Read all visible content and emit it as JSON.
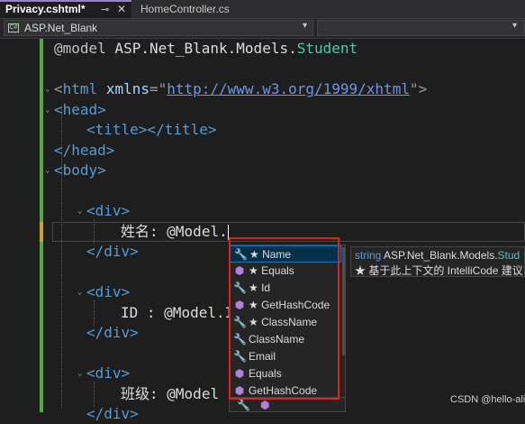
{
  "tabs": [
    {
      "label": "Privacy.cshtml*",
      "pin": "⊸",
      "close": "✕",
      "active": true
    },
    {
      "label": "HomeController.cs",
      "active": false
    }
  ],
  "navbar": {
    "project": "ASP.Net_Blank",
    "chevron": "▾"
  },
  "code": {
    "l1_at": "@model",
    "l1_ns": " ASP.Net_Blank.Models.",
    "l1_type": "Student",
    "l2_open": "<",
    "l2_tag": "html",
    "l2_attr": " xmlns",
    "l2_eq": "=\"",
    "l2_url": "http://www.w3.org/1999/xhtml",
    "l2_close": "\">",
    "l3": "<head>",
    "l4": "<title></title>",
    "l5": "</head>",
    "l6": "<body>",
    "l7": "<div>",
    "l8_text": "姓名: ",
    "l8_model": "@Model.",
    "l9": "</div>",
    "l10": "<div>",
    "l11_text": "ID : ",
    "l11_model": "@Model.I",
    "l12": "</div>",
    "l13": "<div>",
    "l14_text": "班级: ",
    "l14_model": "@Model",
    "l15": "</div>"
  },
  "completion": {
    "items": [
      {
        "icon": "wrench-icon",
        "glyph": "🔧",
        "label": "★ Name",
        "selected": true
      },
      {
        "icon": "method-cube-icon",
        "glyph": "⬢",
        "label": "★ Equals"
      },
      {
        "icon": "wrench-icon",
        "glyph": "🔧",
        "label": "★ Id"
      },
      {
        "icon": "method-cube-icon",
        "glyph": "⬢",
        "label": "★ GetHashCode"
      },
      {
        "icon": "wrench-icon",
        "glyph": "🔧",
        "label": "★ ClassName"
      },
      {
        "icon": "wrench-icon",
        "glyph": "🔧",
        "label": "ClassName"
      },
      {
        "icon": "wrench-icon",
        "glyph": "🔧",
        "label": "Email"
      },
      {
        "icon": "method-cube-icon",
        "glyph": "⬢",
        "label": "Equals"
      },
      {
        "icon": "method-cube-icon",
        "glyph": "⬢",
        "label": "GetHashCode"
      }
    ]
  },
  "tooltip": {
    "kw": "string",
    "type": " ASP.Net_Blank.Models.",
    "cls": "Stud",
    "line2": "★ 基于此上下文的 IntelliCode 建议"
  },
  "watermark": "CSDN @hello-alien",
  "colors": {
    "accent": "#9a7dd8",
    "highlight_box": "#e0211b",
    "change_bar": "#57a64a"
  }
}
